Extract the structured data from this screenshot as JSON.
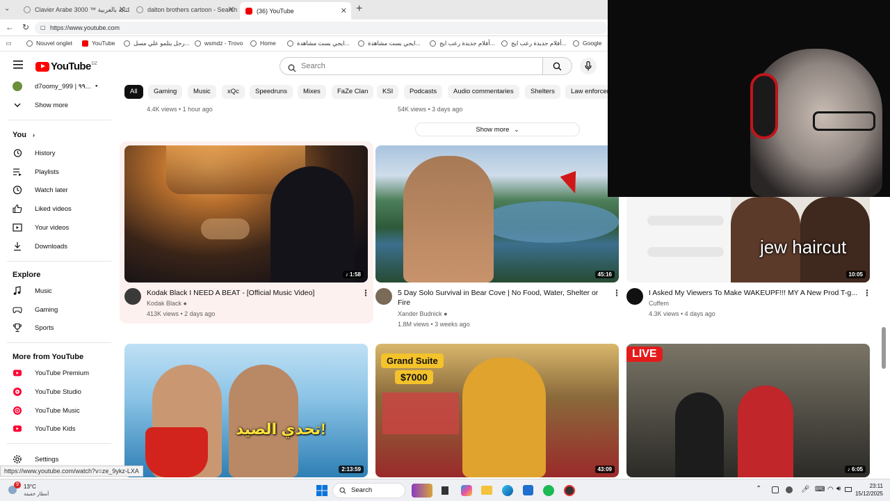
{
  "browser": {
    "tabs": [
      {
        "label": "Clavier Arabe 3000 ™ الكتابة بالعربية",
        "x": 0
      },
      {
        "label": "dalton brothers cartoon - Search",
        "x": 1
      },
      {
        "label": "(36) YouTube",
        "x": 2
      }
    ],
    "url": "https://www.youtube.com",
    "bookmarks": [
      "Nouvel onglet",
      "YouTube",
      "رجل يتلمو علي مسل...",
      "wsmdz - Trovo",
      "Home",
      "ايجي بست مشاهدة...",
      "ايجي بست مشاهدة...",
      "أفلام جديدة رعب ايج...",
      "أفلام جديدة رعب ايج...",
      "Google"
    ]
  },
  "youtube": {
    "logo": "YouTube",
    "country_code": "DZ",
    "search_placeholder": "Search",
    "chips": [
      "All",
      "Gaming",
      "Music",
      "xQc",
      "Speedruns",
      "Mixes",
      "FaZe Clan",
      "KSI",
      "Podcasts",
      "Audio commentaries",
      "Shelters",
      "Law enforcer"
    ],
    "show_more": "Show more"
  },
  "sidebar": {
    "subscription": "d7oomy_999 | ٩٩...",
    "show_more": "Show more",
    "you": "You",
    "you_items": [
      "History",
      "Playlists",
      "Watch later",
      "Liked videos",
      "Your videos",
      "Downloads"
    ],
    "explore": "Explore",
    "explore_items": [
      "Music",
      "Gaming",
      "Sports"
    ],
    "more": "More from YouTube",
    "more_items": [
      "YouTube Premium",
      "YouTube Studio",
      "YouTube Music",
      "YouTube Kids"
    ],
    "settings": "Settings"
  },
  "prev_row": {
    "meta1": "4.4K views • 1 hour ago",
    "meta2": "54K views • 3 days ago"
  },
  "videos": [
    {
      "title": "Kodak Black I NEED A BEAT - [Official Music Video]",
      "channel": "Kodak Black",
      "meta": "413K views • 2 days ago",
      "duration": "1:58"
    },
    {
      "title": "5 Day Solo Survival in Bear Cove | No Food, Water, Shelter or Fire",
      "channel": "Xander Budnick",
      "meta": "1.8M views • 3 weeks ago",
      "duration": "45:16"
    },
    {
      "title": "I Asked My Viewers To Make WAKEUPF!!! MY A New Prod T-g...",
      "channel": "Cuffem",
      "meta": "4.3K views • 4 days ago",
      "duration": "10:05",
      "overlay": "jew haircut"
    },
    {
      "title": "",
      "channel": "",
      "meta": "",
      "duration": "2:13:59",
      "overlay": "تحدي الصيد!"
    },
    {
      "title": "",
      "channel": "",
      "meta": "",
      "duration": "43:09",
      "overlay": "Grand Suite",
      "overlay2": "$7000"
    },
    {
      "title": "",
      "channel": "",
      "meta": "",
      "duration": "6:05",
      "overlay": "LIVE"
    }
  ],
  "status_url": "https://www.youtube.com/watch?v=ze_9ykz-LXA",
  "taskbar": {
    "weather": "13°C",
    "weather_sub": "أمطار خفيفة",
    "badge": "9",
    "search": "Search",
    "time": "23:11",
    "date": "15/12/2025"
  }
}
